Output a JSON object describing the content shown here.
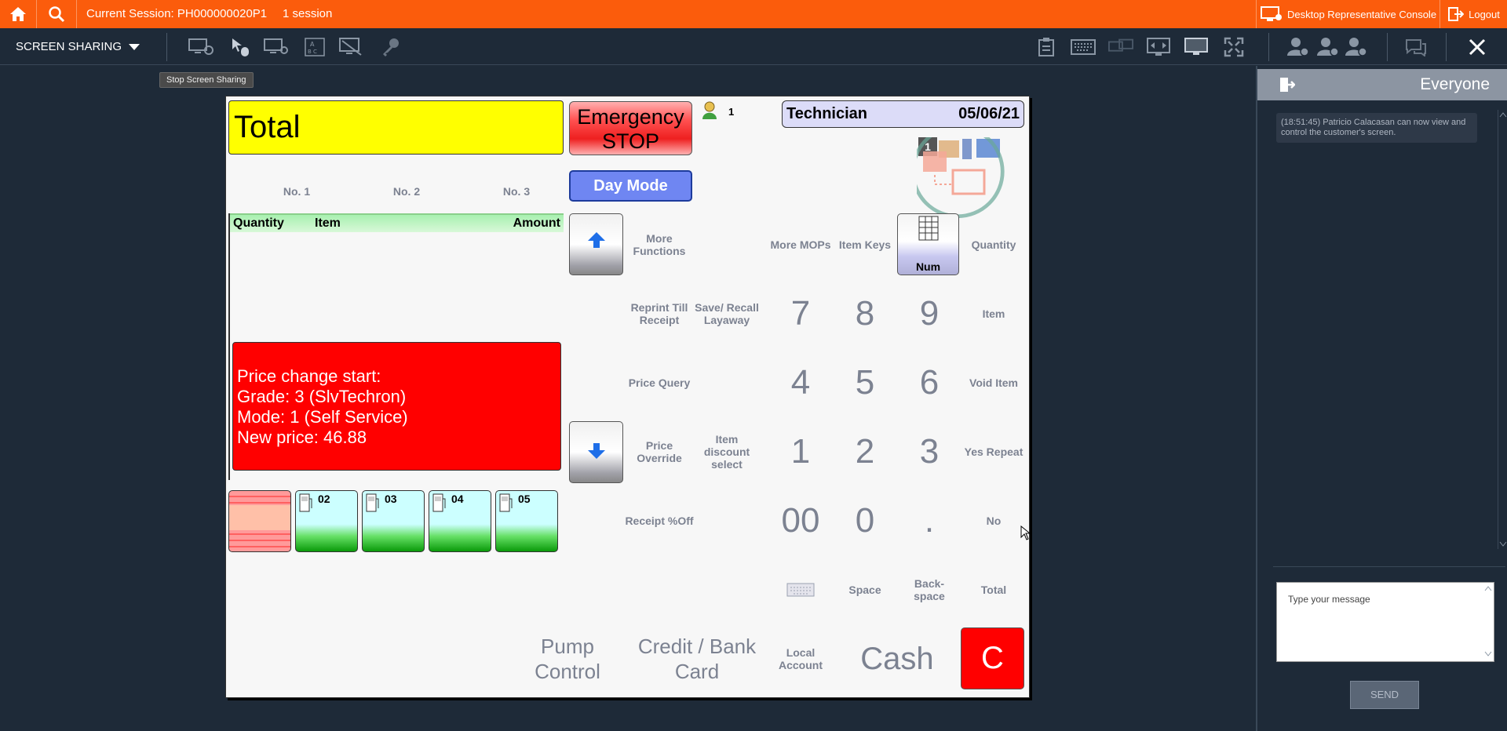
{
  "topbar": {
    "home_icon": "home-icon",
    "search_icon": "search-icon",
    "session_label": "Current Session: PH000000020P1",
    "session_count": "1 session",
    "console_label": "Desktop Representative Console",
    "logout_label": "Logout"
  },
  "toolbar": {
    "screen_sharing_label": "SCREEN SHARING",
    "tooltip": "Stop Screen Sharing"
  },
  "pos": {
    "total_label": "Total",
    "estop_line1": "Emergency",
    "estop_line2": "STOP",
    "operator_count": "1",
    "technician": "Technician",
    "date": "05/06/21",
    "network_badge": "1",
    "day_mode": "Day Mode",
    "tabs": [
      "No. 1",
      "No. 2",
      "No. 3"
    ],
    "item_columns": {
      "quantity": "Quantity",
      "item": "Item",
      "amount": "Amount"
    },
    "price_msg": [
      "Price change start:",
      "Grade: 3 (SlvTechron)",
      "Mode: 1 (Self Service)",
      "New price: 46.88"
    ],
    "pumps": [
      "02",
      "03",
      "04",
      "05"
    ],
    "more_functions": "More Functions",
    "more_mops": "More MOPs",
    "item_keys": "Item Keys",
    "num": "Num",
    "quantity": "Quantity",
    "reprint": "Reprint Till Receipt",
    "save_recall": "Save/ Recall Layaway",
    "item": "Item",
    "price_query": "Price Query",
    "void_item": "Void Item",
    "price_override": "Price Override",
    "item_discount": "Item discount select",
    "yes_repeat": "Yes Repeat",
    "receipt_off": "Receipt %Off",
    "no": "No",
    "space": "Space",
    "backspace": "Back- space",
    "total_key": "Total",
    "pump_control": "Pump Control",
    "credit_card": "Credit / Bank Card",
    "local_account": "Local Account",
    "cash": "Cash",
    "clear": "C",
    "keys": {
      "k7": "7",
      "k8": "8",
      "k9": "9",
      "k4": "4",
      "k5": "5",
      "k6": "6",
      "k1": "1",
      "k2": "2",
      "k3": "3",
      "k00": "00",
      "k0": "0",
      "kdot": "."
    }
  },
  "chat": {
    "title": "Everyone",
    "message": "(18:51:45) Patricio Calacasan can now view and control the customer's screen.",
    "placeholder": "Type your message",
    "send": "SEND"
  },
  "colors": {
    "topbar": "#fb5c0c",
    "background": "#1e2a38",
    "total": "#ffff00",
    "alert": "#ff0000",
    "day_mode": "#6f86f2"
  }
}
